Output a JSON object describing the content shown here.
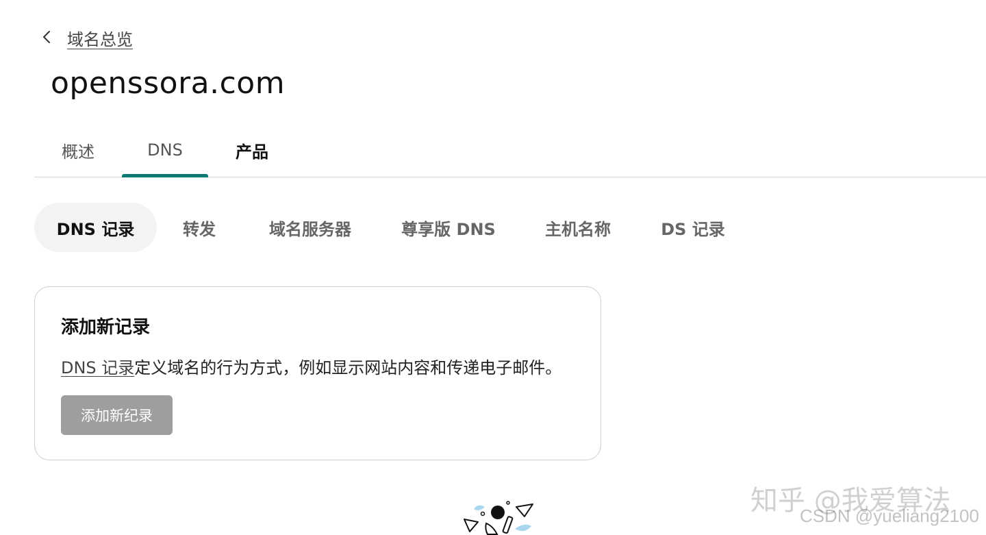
{
  "back_link": {
    "label": "域名总览",
    "icon": "chevron-left-icon"
  },
  "domain_title": "openssora.com",
  "tabs": [
    {
      "label": "概述",
      "active": false
    },
    {
      "label": "DNS",
      "active": true
    },
    {
      "label": "产品",
      "active": false
    }
  ],
  "subtabs": [
    {
      "label": "DNS 记录",
      "active": true
    },
    {
      "label": "转发",
      "active": false
    },
    {
      "label": "域名服务器",
      "active": false
    },
    {
      "label": "尊享版 DNS",
      "active": false
    },
    {
      "label": "主机名称",
      "active": false
    },
    {
      "label": "DS 记录",
      "active": false
    }
  ],
  "card": {
    "title": "添加新记录",
    "description_link": "DNS 记录",
    "description_rest": "定义域名的行为方式，例如显示网站内容和传递电子邮件。",
    "button_label": "添加新纪录"
  },
  "watermarks": {
    "line1": "知乎 @我爱算法",
    "line2": "CSDN @yueliang2100"
  },
  "colors": {
    "tab_indicator": "#0b7a72",
    "button_disabled": "#9e9e9e",
    "pill_active_bg": "#f3f3f3"
  }
}
